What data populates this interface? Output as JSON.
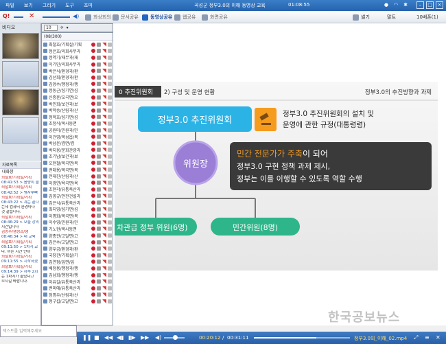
{
  "titlebar": {
    "menu": [
      "파일",
      "보기",
      "그리기",
      "도구",
      "조미"
    ],
    "title": "곡성군 정부3.0의 이해 동영상 교육",
    "time": "01:08:55"
  },
  "toolbar": {
    "tabs": [
      "화상회의",
      "문서공유",
      "동영상공유",
      "웹공유",
      "화면공유"
    ],
    "active_tab": "동영상공유",
    "right": [
      "썰기",
      "말트",
      "10배폰(1)"
    ]
  },
  "left": {
    "video_label": "비디오",
    "video_count": "10",
    "list_label": "자료목록",
    "chat_label": "대화창"
  },
  "userlist": {
    "count": "(08/300)",
    "users": [
      "최철호/기획실/기획",
      "정은호/의회사무과",
      "정약기/재무과/재",
      "이기민/의회사무과",
      "박은식/환경과/환",
      "김선희/환경과/환",
      "김앙수/행정과/행",
      "정동근/섬기연/섬",
      "신종훈/오곡면/오",
      "박민희/보건과/보",
      "박학승/산림과/산",
      "정학호/섬기면/섬",
      "조정식/목사동면",
      "공원미/민원과/민",
      "이건영/목성읍/목",
      "박남운/겸면/겸",
      "박지웅/문화관광과",
      "조기남/보건과/보",
      "오현철/목곡면/목",
      "권태용/목곡면/목",
      "전재진/산림과/산",
      "이광연/욕곡면/욕",
      "조현각/유통축산과",
      "김영규/안전건설과",
      "김은식/유통축산과",
      "최지영/섬기면/섬",
      "이명화/목곡면/목",
      "이수영/민원과/민",
      "기노현/목사동면",
      "양종관/고달면/고",
      "김은수/고달면/고",
      "양우금/환경과/환",
      "국장관/기획실/기",
      "김연정/입면/입",
      "배정용/행정과/행",
      "김남희/행정과/행",
      "이유길/유통축산과",
      "권미애/유통축산과",
      "정명우/산림과/산",
      "정구섭/고달면/고"
    ]
  },
  "chat": {
    "messages": [
      "최철호/기획실/기획",
      "08:41:53 > 음량이 클",
      "최철호/기획실/기획",
      "08:42:52 > 펭자부빠",
      "최철호/기획실/기획",
      "08:43:22 > 계는 끝나",
      "는데 컴퓨터 환경마다",
      "것 같습니다.",
      "최철호/기획실/기획",
      "08:46:29 > 오늘 강의",
      "시간입니다",
      "김앙수/행정과/행",
      "08:46:34 > 내 교육",
      "최철호/기획실/기획",
      "09:11:50 > 1차시 교",
      "다. 어는 시간 만이",
      "최철호/기획실/기획",
      "09:11:55 > 시작하겠",
      "최철호/기획실/기획",
      "09:14:39 > 하루 2회",
      "는 1차시가 끝났다고",
      "으시길 바랍니다."
    ],
    "input_placeholder": "텍스트를 입력해주세요"
  },
  "slide": {
    "header_left": "0 추진위원회",
    "header_mid": "2) 구성 및 운영 현황",
    "header_right": "정부3.0의 추진방향과 과제",
    "box_committee": "정부3.0 추진위원회",
    "regulation": "정부3.0 추진위원회의 설치 및 운영에 관한 규정(대통령령)",
    "regulation_line1": "정부3.0 추진위원회의 설치 및",
    "regulation_line2": "운영에 관한 규정(대통령령)",
    "chair": "위원장",
    "dark_line1_a": "민간 전문가가 주축",
    "dark_line1_b": "이 되어",
    "dark_line2": "정부3.0 구현 정책 과제 제시,",
    "dark_line3": "정부는 이를 이행할 수 있도록 역할 수행",
    "gov_members": "차관급 정부 위원(6명)",
    "civil_members": "민간위원(8명)"
  },
  "player": {
    "current_time": "00:20:12",
    "total_time": "00:31:11",
    "progress": 0.65,
    "filename": "정부3.0의_이해_02.mp4"
  },
  "watermark": "한국공보뉴스",
  "colors": {
    "titlebar": "#2f6fb8",
    "slide_cyan": "#2cb3e6",
    "slide_purple": "#9b7fd6",
    "slide_green": "#2fb58a",
    "dark_box": "#3a3a3a",
    "highlight_orange": "#f59b1e"
  }
}
